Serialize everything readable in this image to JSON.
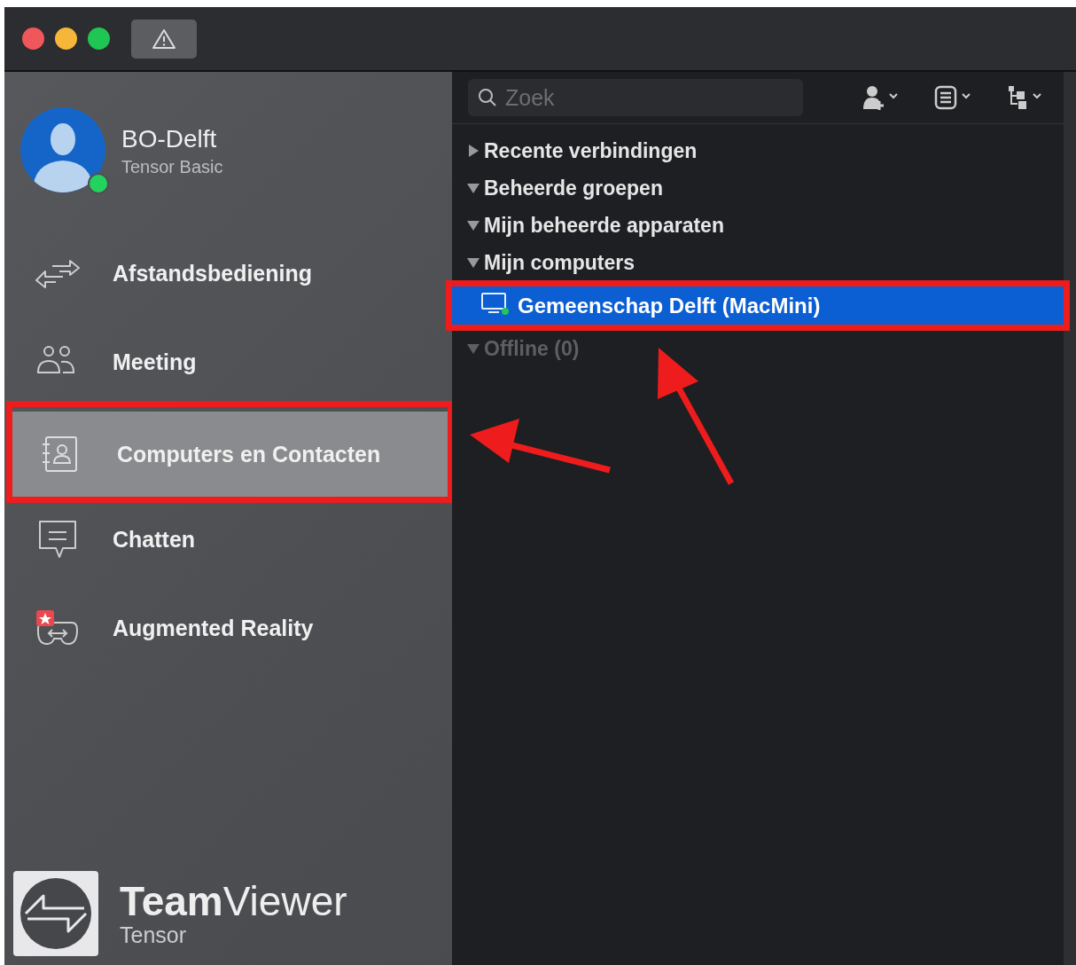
{
  "profile": {
    "name": "BO-Delft",
    "plan": "Tensor Basic",
    "online": true
  },
  "nav": [
    {
      "kind": "remote",
      "label": "Afstandsbediening",
      "selected": false,
      "annotated": false
    },
    {
      "kind": "meeting",
      "label": "Meeting",
      "selected": false,
      "annotated": false
    },
    {
      "kind": "contacts",
      "label": "Computers en Contacten",
      "selected": true,
      "annotated": true
    },
    {
      "kind": "chat",
      "label": "Chatten",
      "selected": false,
      "annotated": false
    },
    {
      "kind": "ar",
      "label": "Augmented Reality",
      "selected": false,
      "annotated": false
    }
  ],
  "logo": {
    "name": "**Team**Viewer",
    "edition": "Tensor"
  },
  "search": {
    "placeholder": "Zoek"
  },
  "tree": [
    {
      "label": "Recente verbindingen",
      "expanded": false,
      "disabled": false
    },
    {
      "label": "Beheerde groepen",
      "expanded": true,
      "disabled": false
    },
    {
      "label": "Mijn beheerde apparaten",
      "expanded": true,
      "disabled": false
    },
    {
      "label": "Mijn computers",
      "expanded": true,
      "disabled": false,
      "children": [
        {
          "label": "Gemeenschap Delft (MacMini)",
          "online": true,
          "selected": true,
          "annotated": true
        }
      ]
    },
    {
      "label": "Offline (0)",
      "expanded": true,
      "disabled": true
    }
  ]
}
